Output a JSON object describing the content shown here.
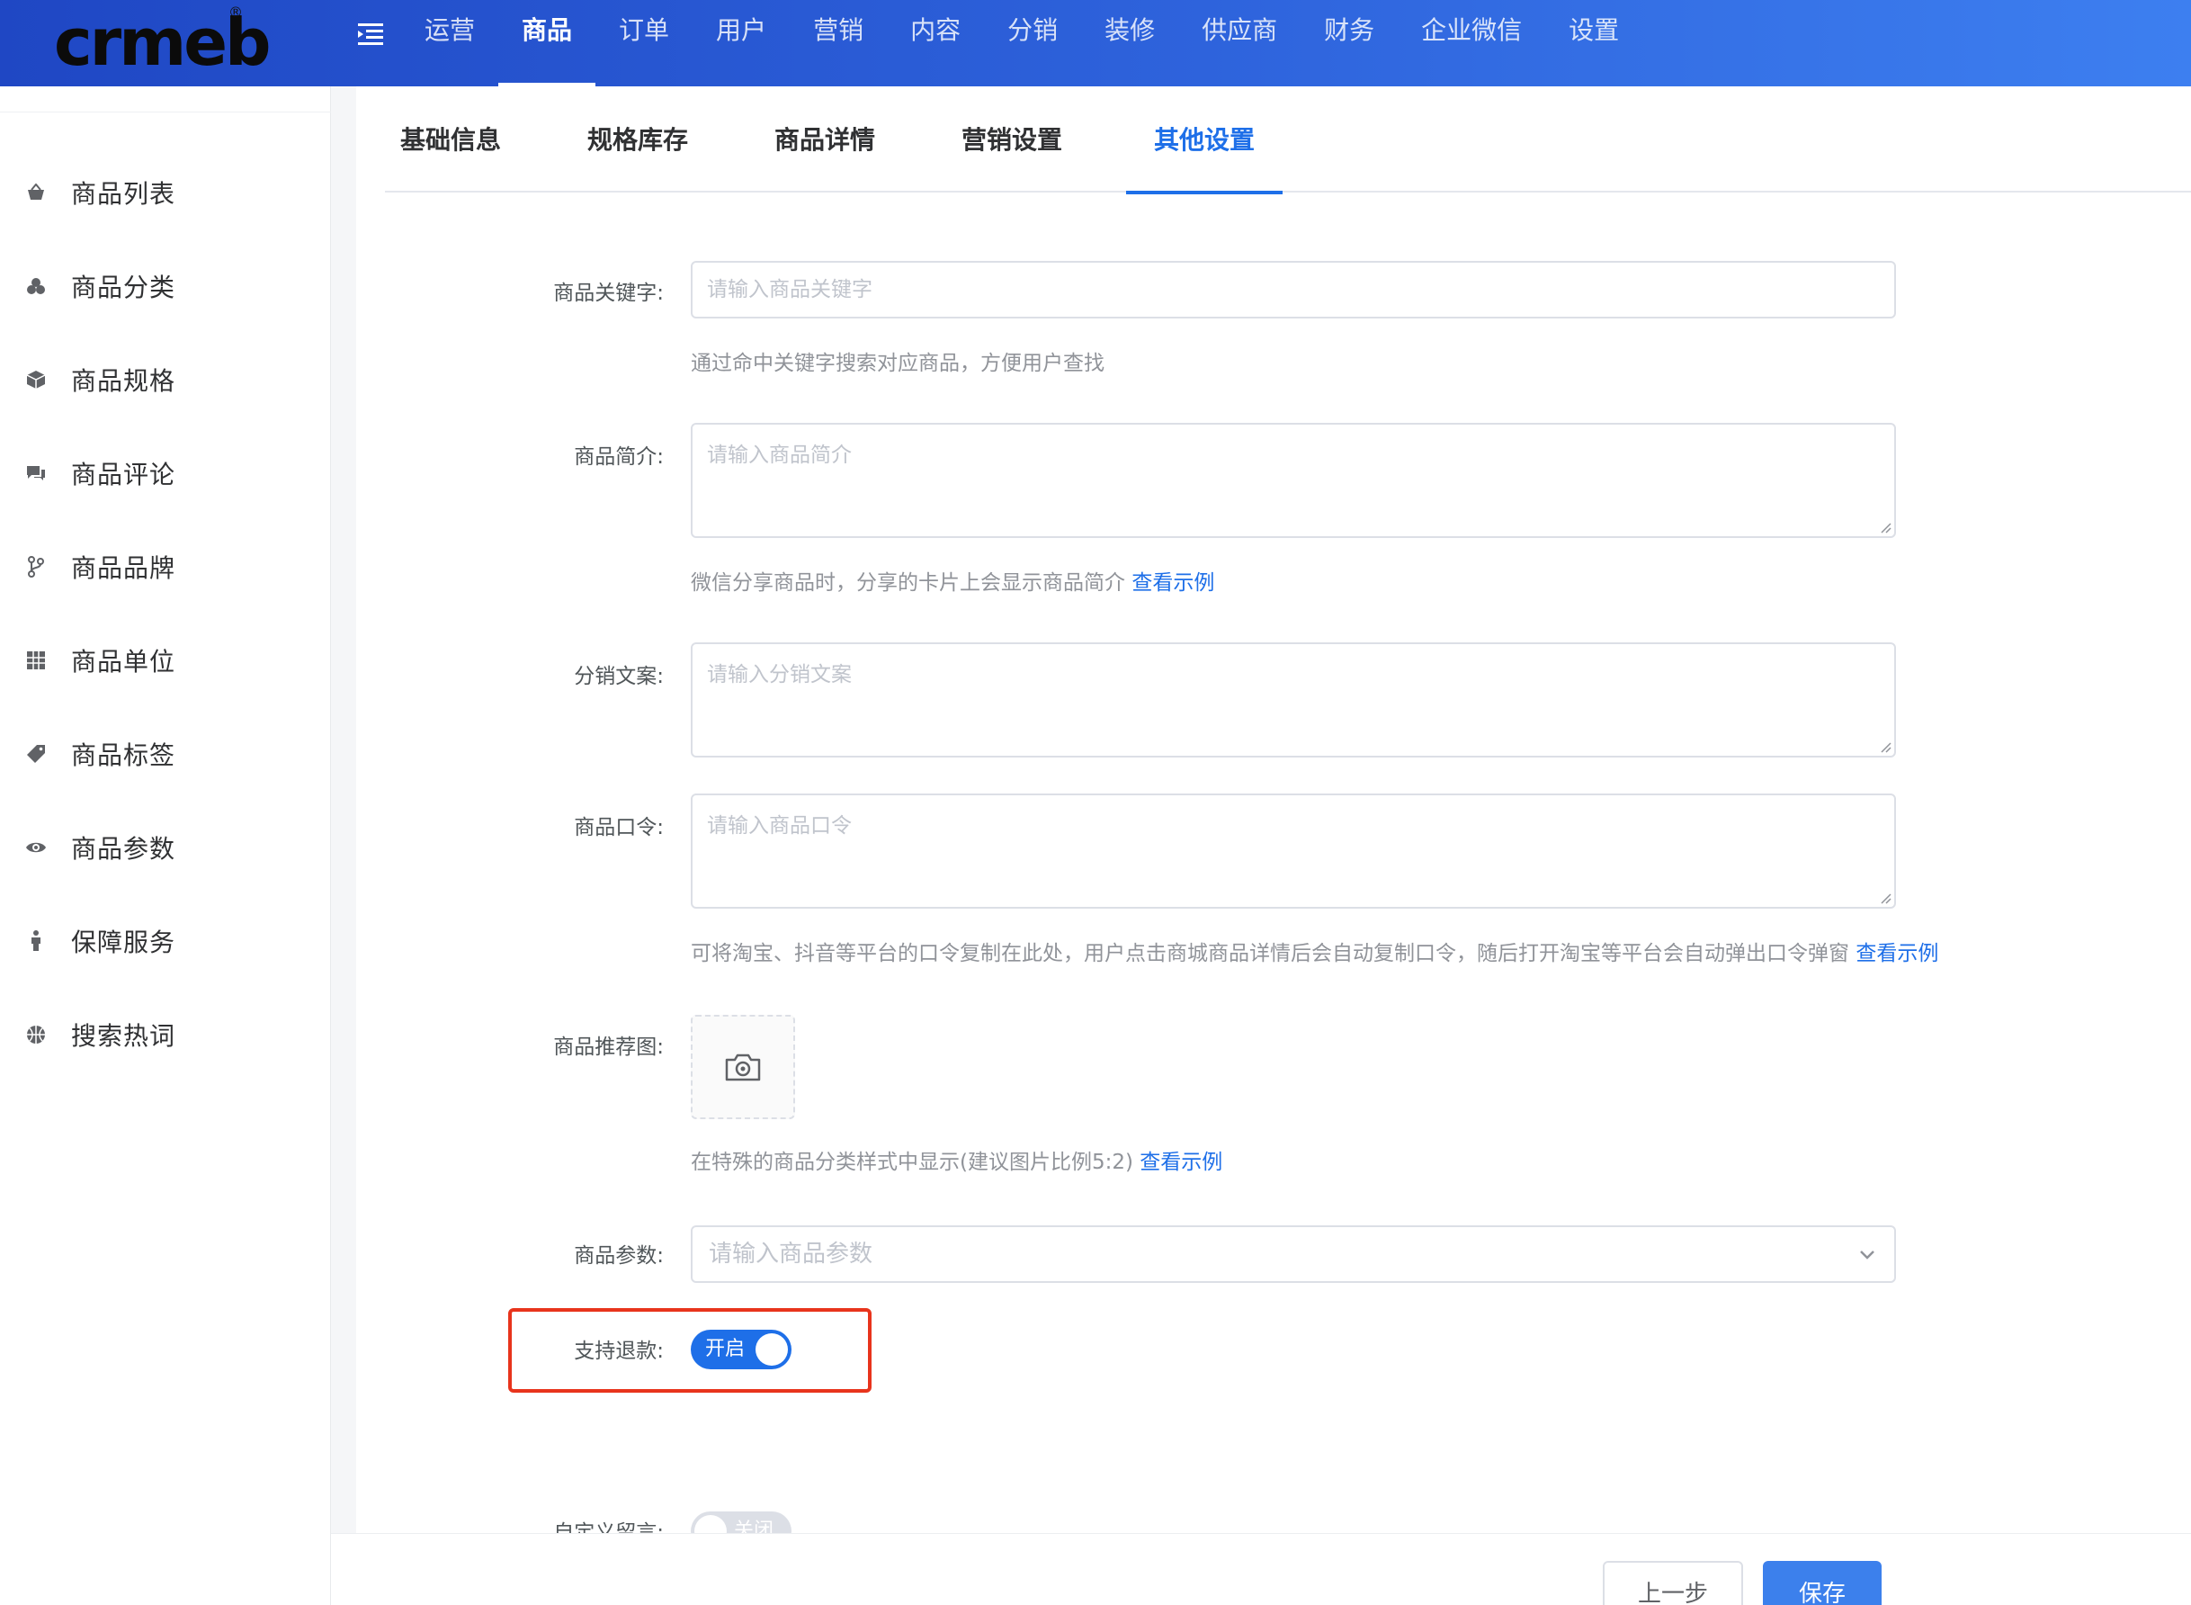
{
  "logo": {
    "text": "crmeb",
    "mark": "®"
  },
  "topnav": {
    "items": [
      {
        "label": "运营"
      },
      {
        "label": "商品"
      },
      {
        "label": "订单"
      },
      {
        "label": "用户"
      },
      {
        "label": "营销"
      },
      {
        "label": "内容"
      },
      {
        "label": "分销"
      },
      {
        "label": "装修"
      },
      {
        "label": "供应商"
      },
      {
        "label": "财务"
      },
      {
        "label": "企业微信"
      },
      {
        "label": "设置"
      }
    ],
    "active_index": 1
  },
  "sidebar": {
    "items": [
      {
        "label": "商品列表",
        "icon": "basket-icon"
      },
      {
        "label": "商品分类",
        "icon": "cubes-icon"
      },
      {
        "label": "商品规格",
        "icon": "box-icon"
      },
      {
        "label": "商品评论",
        "icon": "comments-icon"
      },
      {
        "label": "商品品牌",
        "icon": "branch-icon"
      },
      {
        "label": "商品单位",
        "icon": "grid-icon"
      },
      {
        "label": "商品标签",
        "icon": "tag-icon"
      },
      {
        "label": "商品参数",
        "icon": "eye-icon"
      },
      {
        "label": "保障服务",
        "icon": "person-icon"
      },
      {
        "label": "搜索热词",
        "icon": "basketball-icon"
      }
    ]
  },
  "tabs": {
    "items": [
      {
        "label": "基础信息"
      },
      {
        "label": "规格库存"
      },
      {
        "label": "商品详情"
      },
      {
        "label": "营销设置"
      },
      {
        "label": "其他设置"
      }
    ],
    "active_index": 4
  },
  "form": {
    "keyword": {
      "label": "商品关键字:",
      "placeholder": "请输入商品关键字",
      "help": "通过命中关键字搜索对应商品，方便用户查找"
    },
    "intro": {
      "label": "商品简介:",
      "placeholder": "请输入商品简介",
      "help": "微信分享商品时，分享的卡片上会显示商品简介",
      "link": "查看示例"
    },
    "copy": {
      "label": "分销文案:",
      "placeholder": "请输入分销文案"
    },
    "token": {
      "label": "商品口令:",
      "placeholder": "请输入商品口令",
      "help": "可将淘宝、抖音等平台的口令复制在此处，用户点击商城商品详情后会自动复制口令，随后打开淘宝等平台会自动弹出口令弹窗",
      "link": "查看示例"
    },
    "recommend_image": {
      "label": "商品推荐图:",
      "help": "在特殊的商品分类样式中显示(建议图片比例5:2)",
      "link": "查看示例"
    },
    "params": {
      "label": "商品参数:",
      "placeholder": "请输入商品参数"
    },
    "refund": {
      "label": "支持退款:",
      "state": "开启",
      "on": true
    },
    "custom_message": {
      "label": "自定义留言:",
      "state": "关闭",
      "on": false
    }
  },
  "footer": {
    "prev_label": "上一步",
    "save_label": "保存"
  },
  "colors": {
    "primary": "#1e6fe8",
    "highlight": "#e8341c",
    "header_start": "#1f47c4",
    "header_end": "#3d7ff0"
  }
}
